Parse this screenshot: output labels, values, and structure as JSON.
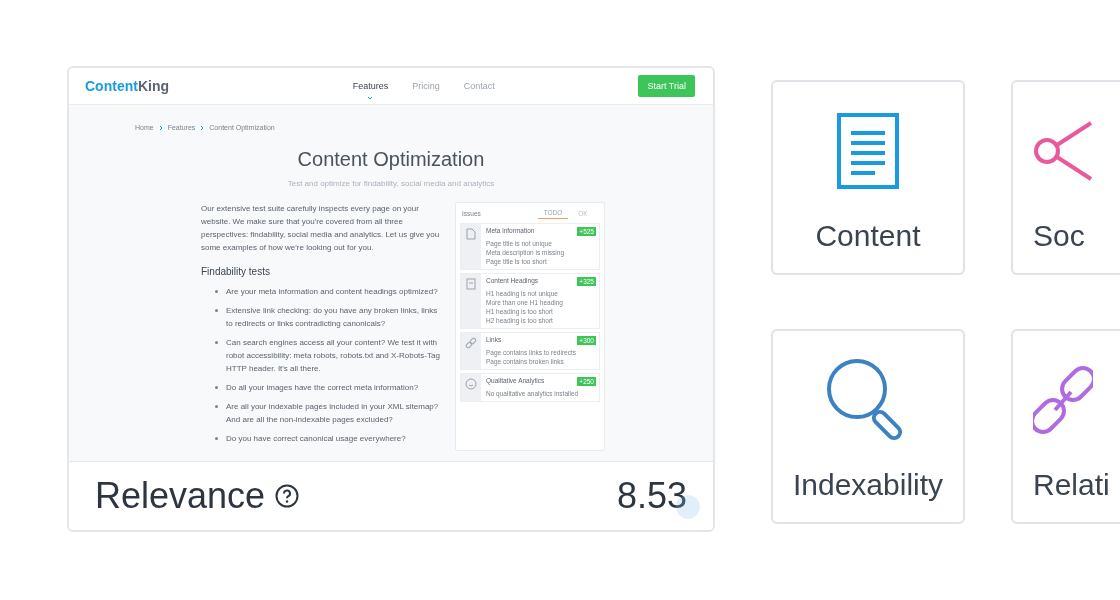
{
  "preview": {
    "logo": {
      "part_1": "Content",
      "part_2": "King"
    },
    "nav": [
      {
        "label": "Features",
        "selected": true
      },
      {
        "label": "Pricing",
        "selected": false
      },
      {
        "label": "Contact",
        "selected": false
      }
    ],
    "cta": "Start Trial",
    "breadcrumb": [
      "Home",
      "Features",
      "Content Optimization"
    ],
    "title": "Content Optimization",
    "subtitle": "Test and optimize for findability, social media and analytics",
    "intro": "Our extensive test suite carefully inspects every page on your website. We make sure that you're covered from all three perspectives: findability, social media and analytics. Let us give you some examples of how we're looking out for you.",
    "section_heading": "Findability tests",
    "bullets": [
      "Are your meta information and content headings optimized?",
      "Extensive link checking: do you have any broken links, links to redirects or links contradicting canonicals?",
      "Can search engines access all your content? We test it with robot accessibility: meta robots, robots.txt and X-Robots-Tag HTTP header. It's all there.",
      "Do all your images have the correct meta information?",
      "Are all your indexable pages included in your XML sitemap? And are all the non-indexable pages excluded?",
      "Do you have correct canonical usage everywhere?"
    ],
    "issues_panel": {
      "title": "Issues",
      "tabs": [
        {
          "label": "TODO",
          "selected": true
        },
        {
          "label": "OK",
          "selected": false
        }
      ],
      "items": [
        {
          "kind": "document",
          "title": "Meta information",
          "badge": "+525",
          "lines": [
            "Page title is not unique",
            "Meta description is missing",
            "Page title is too short"
          ]
        },
        {
          "kind": "heading",
          "title": "Content Headings",
          "badge": "+325",
          "lines": [
            "H1 heading is not unique",
            "More than one H1 heading",
            "H1 heading is too short",
            "H2 heading is too short"
          ]
        },
        {
          "kind": "link",
          "title": "Links",
          "badge": "+300",
          "lines": [
            "Page contains links to redirects",
            "Page contains broken links"
          ]
        },
        {
          "kind": "analytics",
          "title": "Qualitative Analytics",
          "badge": "+250",
          "lines": [
            "No qualitative analytics installed"
          ]
        }
      ]
    }
  },
  "score": {
    "label": "Relevance",
    "value": "8.53"
  },
  "categories": [
    {
      "kind": "content",
      "label": "Content"
    },
    {
      "kind": "social",
      "label": "Soc"
    },
    {
      "kind": "indexability",
      "label": "Indexability"
    },
    {
      "kind": "relations",
      "label": "Relati"
    }
  ]
}
